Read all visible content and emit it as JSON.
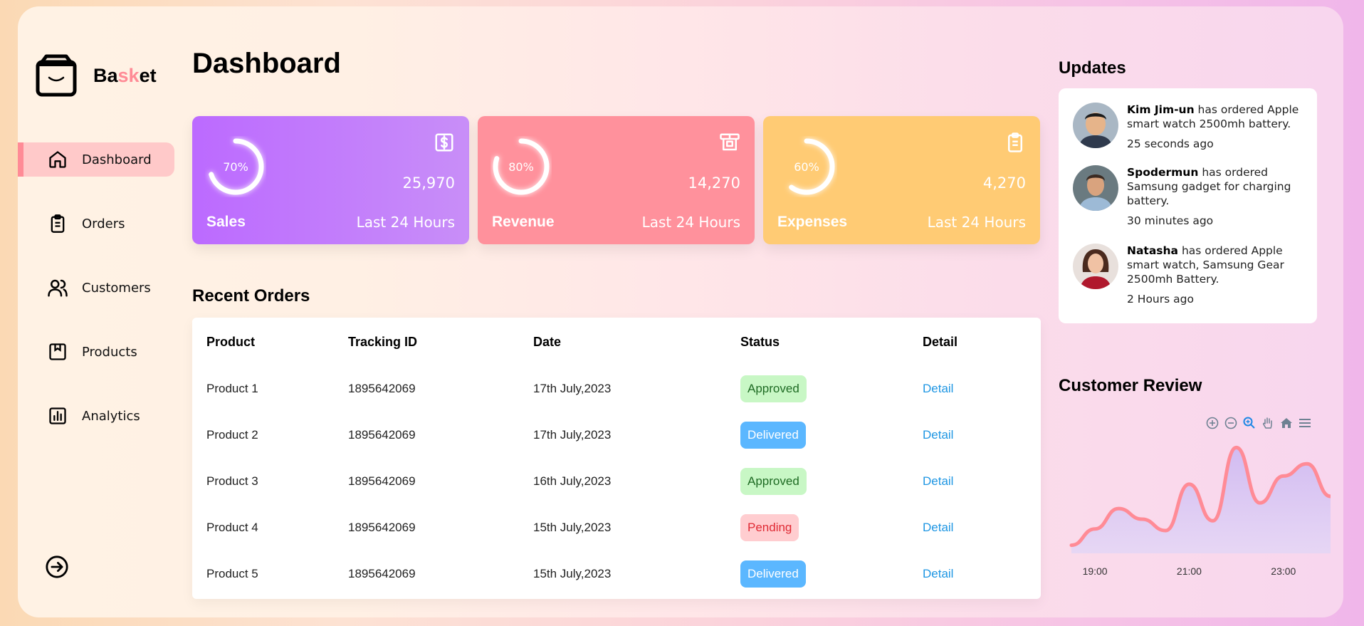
{
  "brand": {
    "part1": "Ba",
    "part2": "sk",
    "part3": "et"
  },
  "sidebar": {
    "items": [
      {
        "label": "Dashboard",
        "icon": "home-icon",
        "active": true
      },
      {
        "label": "Orders",
        "icon": "clipboard-icon",
        "active": false
      },
      {
        "label": "Customers",
        "icon": "users-icon",
        "active": false
      },
      {
        "label": "Products",
        "icon": "box-icon",
        "active": false
      },
      {
        "label": "Analytics",
        "icon": "bar-chart-icon",
        "active": false
      }
    ],
    "logout_icon": "logout-icon"
  },
  "header": {
    "title": "Dashboard"
  },
  "cards": [
    {
      "name": "Sales",
      "percent": "70%",
      "percent_value": 70,
      "value": "25,970",
      "period": "Last 24 Hours",
      "icon": "dollar-icon",
      "color": "#bc6aff"
    },
    {
      "name": "Revenue",
      "percent": "80%",
      "percent_value": 80,
      "value": "14,270",
      "period": "Last 24 Hours",
      "icon": "cash-register-icon",
      "color": "#ff919c"
    },
    {
      "name": "Expenses",
      "percent": "60%",
      "percent_value": 60,
      "value": "4,270",
      "period": "Last 24 Hours",
      "icon": "clipboard-icon",
      "color": "#ffcb74"
    }
  ],
  "orders": {
    "title": "Recent Orders",
    "columns": [
      "Product",
      "Tracking ID",
      "Date",
      "Status",
      "Detail"
    ],
    "rows": [
      {
        "product": "Product 1",
        "tracking": "1895642069",
        "date": "17th July,2023",
        "status": "Approved",
        "detail": "Detail"
      },
      {
        "product": "Product 2",
        "tracking": "1895642069",
        "date": "17th July,2023",
        "status": "Delivered",
        "detail": "Detail"
      },
      {
        "product": "Product 3",
        "tracking": "1895642069",
        "date": "16th July,2023",
        "status": "Approved",
        "detail": "Detail"
      },
      {
        "product": "Product 4",
        "tracking": "1895642069",
        "date": "15th July,2023",
        "status": "Pending",
        "detail": "Detail"
      },
      {
        "product": "Product 5",
        "tracking": "1895642069",
        "date": "15th July,2023",
        "status": "Delivered",
        "detail": "Detail"
      }
    ],
    "status_colors": {
      "Approved": "#c8f7c5",
      "Delivered": "#5bb7ff",
      "Pending": "#ffcdd0"
    }
  },
  "updates": {
    "title": "Updates",
    "items": [
      {
        "name": "Kim Jim-un",
        "text": "has ordered Apple smart watch 2500mh battery.",
        "time": "25 seconds ago"
      },
      {
        "name": "Spodermun",
        "text": "has ordered Samsung gadget for charging battery.",
        "time": "30 minutes ago"
      },
      {
        "name": "Natasha",
        "text": "has ordered Apple smart watch, Samsung Gear 2500mh Battery.",
        "time": "2 Hours ago"
      }
    ]
  },
  "review": {
    "title": "Customer Review",
    "tools": [
      "zoom-in-icon",
      "zoom-out-icon",
      "magnifier-icon",
      "pan-hand-icon",
      "home-reset-icon",
      "menu-icon"
    ]
  },
  "chart_data": {
    "type": "area",
    "x": [
      "18:30",
      "19:00",
      "19:30",
      "20:00",
      "20:30",
      "21:00",
      "21:30",
      "22:00",
      "22:30",
      "23:00",
      "23:30",
      "24:00"
    ],
    "x_tick_labels": [
      "19:00",
      "21:00",
      "23:00"
    ],
    "values": [
      10,
      30,
      55,
      42,
      28,
      85,
      40,
      130,
      62,
      95,
      110,
      70
    ],
    "color": "#ff8b96",
    "fill_color": "#d6c6f4",
    "grid": false,
    "legend": "none"
  }
}
